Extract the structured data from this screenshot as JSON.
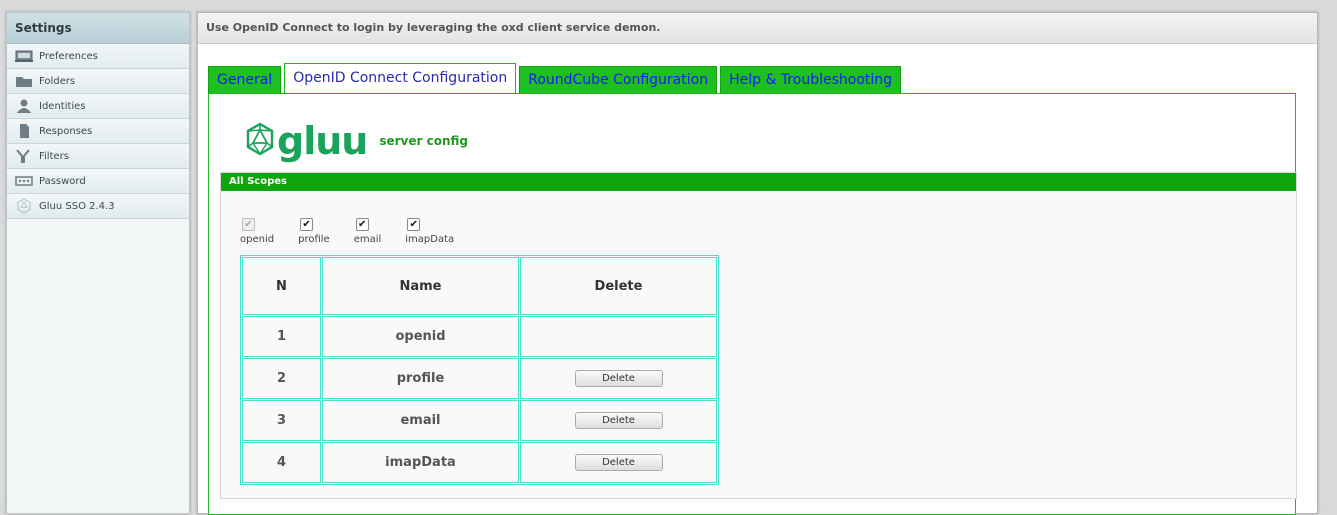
{
  "sidebar": {
    "title": "Settings",
    "items": [
      {
        "label": "Preferences",
        "icon": "monitor-icon"
      },
      {
        "label": "Folders",
        "icon": "folder-icon"
      },
      {
        "label": "Identities",
        "icon": "user-icon"
      },
      {
        "label": "Responses",
        "icon": "document-icon"
      },
      {
        "label": "Filters",
        "icon": "filter-icon"
      },
      {
        "label": "Password",
        "icon": "password-icon"
      },
      {
        "label": "Gluu SSO 2.4.3",
        "icon": "gluu-icon"
      }
    ]
  },
  "main": {
    "header": "Use OpenID Connect to login by leveraging the oxd client service demon.",
    "tabs": [
      {
        "label": "General",
        "active": false
      },
      {
        "label": "OpenID Connect Configuration",
        "active": true
      },
      {
        "label": "RoundCube Configuration",
        "active": false
      },
      {
        "label": "Help & Troubleshooting",
        "active": false
      }
    ],
    "logo_text": "gluu",
    "server_config": "server config",
    "scopes": {
      "header": "All Scopes",
      "checkboxes": [
        {
          "label": "openid",
          "checked": true,
          "disabled": true
        },
        {
          "label": "profile",
          "checked": true,
          "disabled": false
        },
        {
          "label": "email",
          "checked": true,
          "disabled": false
        },
        {
          "label": "imapData",
          "checked": true,
          "disabled": false
        }
      ],
      "table": {
        "columns": [
          "N",
          "Name",
          "Delete"
        ],
        "rows": [
          {
            "n": "1",
            "name": "openid",
            "delete": ""
          },
          {
            "n": "2",
            "name": "profile",
            "delete": "Delete"
          },
          {
            "n": "3",
            "name": "email",
            "delete": "Delete"
          },
          {
            "n": "4",
            "name": "imapData",
            "delete": "Delete"
          }
        ]
      }
    }
  },
  "colors": {
    "tab_green": "#1ebf1e",
    "tab_text": "#1a1aff",
    "scope_header": "#0fa50f",
    "table_border": "#45e0c8",
    "gluu_green": "#1aa35a"
  }
}
